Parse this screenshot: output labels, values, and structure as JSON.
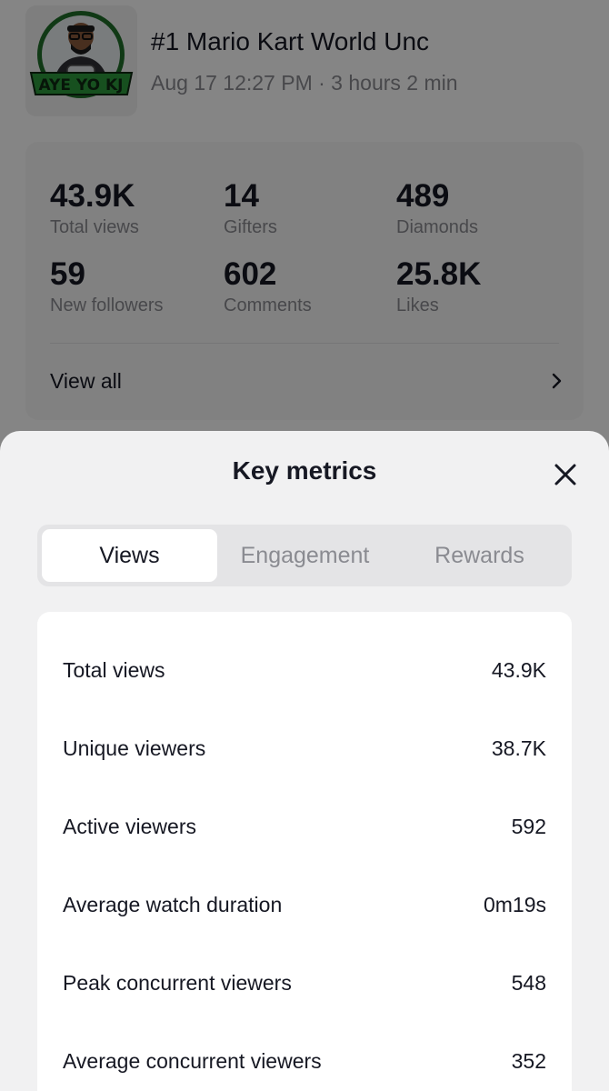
{
  "live": {
    "title": "#1 Mario Kart World Unc",
    "meta": "Aug 17 12:27 PM · 3 hours 2 min",
    "thumbnail_text": "AYE YO KJ"
  },
  "stats": [
    {
      "value": "43.9K",
      "label": "Total views"
    },
    {
      "value": "14",
      "label": "Gifters"
    },
    {
      "value": "489",
      "label": "Diamonds"
    },
    {
      "value": "59",
      "label": "New followers"
    },
    {
      "value": "602",
      "label": "Comments"
    },
    {
      "value": "25.8K",
      "label": "Likes"
    }
  ],
  "view_all_label": "View all",
  "sheet": {
    "title": "Key metrics",
    "tabs": [
      {
        "label": "Views",
        "active": true
      },
      {
        "label": "Engagement",
        "active": false
      },
      {
        "label": "Rewards",
        "active": false
      }
    ],
    "metrics": [
      {
        "label": "Total views",
        "value": "43.9K"
      },
      {
        "label": "Unique viewers",
        "value": "38.7K"
      },
      {
        "label": "Active viewers",
        "value": "592"
      },
      {
        "label": "Average watch duration",
        "value": "0m19s"
      },
      {
        "label": "Peak concurrent viewers",
        "value": "548"
      },
      {
        "label": "Average concurrent viewers",
        "value": "352"
      }
    ]
  },
  "icons": {
    "view_all": "chevron-right-icon",
    "close": "close-icon"
  },
  "colors": {
    "logo_green": "#2d9a3c",
    "overlay": "rgba(0,0,0,0.48)",
    "sheet_bg": "#f1f1f2",
    "muted_text": "#8a8b91"
  }
}
